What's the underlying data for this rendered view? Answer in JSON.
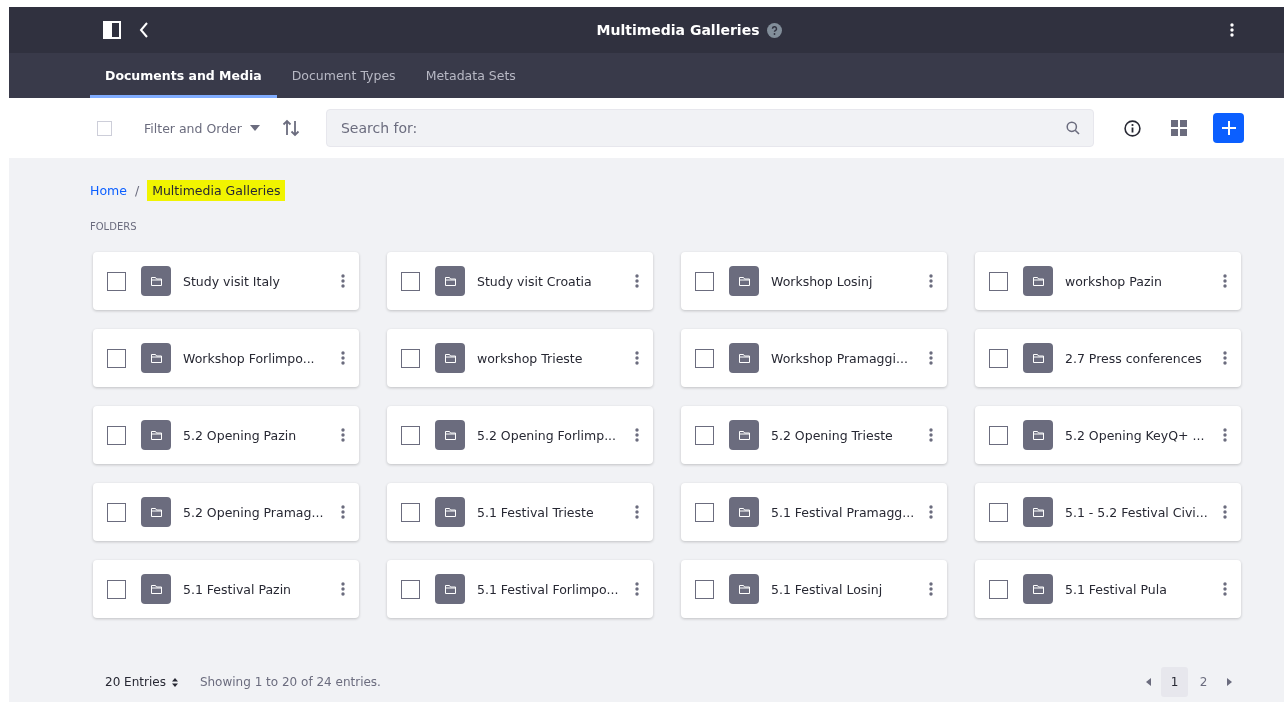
{
  "header": {
    "title": "Multimedia Galleries"
  },
  "tabs": [
    {
      "label": "Documents and Media",
      "selected": true
    },
    {
      "label": "Document Types",
      "selected": false
    },
    {
      "label": "Metadata Sets",
      "selected": false
    }
  ],
  "toolbar": {
    "select_all_checked": false,
    "filter_label": "Filter and Order",
    "search": {
      "placeholder": "Search for:"
    }
  },
  "breadcrumb": [
    {
      "label": "Home",
      "kind": "link"
    },
    {
      "label": "Multimedia Galleries",
      "kind": "highlighted",
      "separator": "/"
    }
  ],
  "section_label": "FOLDERS",
  "folders": [
    {
      "name": "Study visit Italy",
      "checked": false
    },
    {
      "name": "Study visit Croatia",
      "checked": false
    },
    {
      "name": "Workshop Losinj",
      "checked": false
    },
    {
      "name": "workshop Pazin",
      "checked": false
    },
    {
      "name": "Workshop Forlimpo...",
      "checked": false
    },
    {
      "name": "workshop Trieste",
      "checked": false
    },
    {
      "name": "Workshop Pramaggi...",
      "checked": false
    },
    {
      "name": "2.7 Press conferences",
      "checked": false
    },
    {
      "name": "5.2 Opening Pazin",
      "checked": false
    },
    {
      "name": "5.2 Opening Forlimp...",
      "checked": false
    },
    {
      "name": "5.2 Opening Trieste",
      "checked": false
    },
    {
      "name": "5.2 Opening KeyQ+ ...",
      "checked": false
    },
    {
      "name": "5.2 Opening Pramag...",
      "checked": false
    },
    {
      "name": "5.1 Festival Trieste",
      "checked": false
    },
    {
      "name": "5.1 Festival Pramagg...",
      "checked": false
    },
    {
      "name": "5.1 - 5.2 Festival Civi...",
      "checked": false
    },
    {
      "name": "5.1 Festival Pazin",
      "checked": false
    },
    {
      "name": "5.1 Festival Forlimpo...",
      "checked": false
    },
    {
      "name": "5.1 Festival Losinj",
      "checked": false
    },
    {
      "name": "5.1 Festival Pula",
      "checked": false
    }
  ],
  "footer": {
    "entries": "20 Entries",
    "summary": "Showing 1 to 20 of 24 entries.",
    "pages": [
      {
        "label": "1",
        "selected": true
      },
      {
        "label": "2",
        "selected": false
      }
    ]
  }
}
